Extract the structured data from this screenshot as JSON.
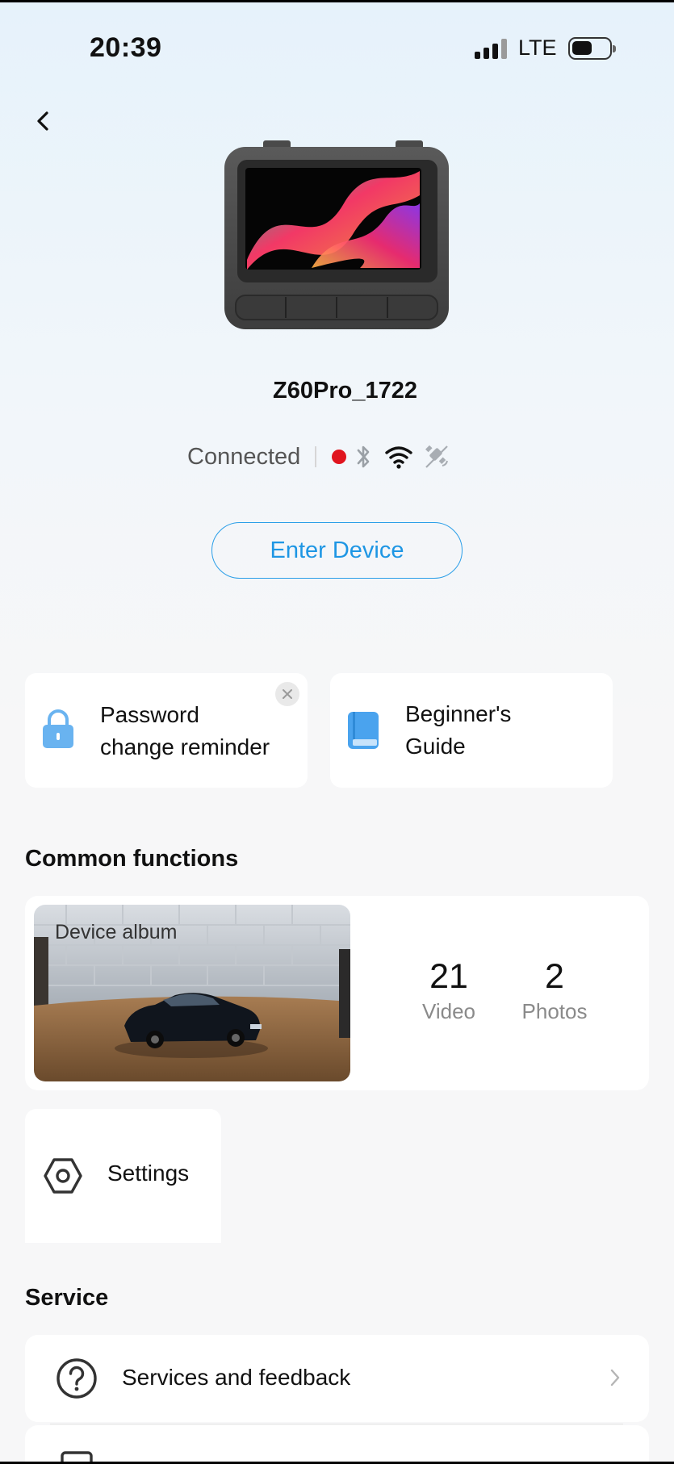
{
  "status_bar": {
    "time": "20:39",
    "network": "LTE",
    "signal_bars": 4,
    "battery_level": 0.5
  },
  "header": {
    "back_icon": "chevron-left-icon"
  },
  "device": {
    "name": "Z60Pro_1722",
    "status": "Connected",
    "status_icons": [
      "recording-dot-icon",
      "bluetooth-icon",
      "wifi-icon",
      "gps-off-icon"
    ],
    "recording_color": "#e0141e"
  },
  "enter_button": {
    "label": "Enter Device"
  },
  "quick_cards": {
    "reminder_line1": "Password",
    "reminder_line2": "change reminder",
    "guide_line1": "Beginner's",
    "guide_line2": "Guide"
  },
  "common_functions": {
    "title": "Common functions",
    "album": {
      "label": "Device album",
      "video_count": "21",
      "video_label": "Video",
      "photo_count": "2",
      "photo_label": "Photos"
    },
    "settings_label": "Settings"
  },
  "service": {
    "title": "Service",
    "items": [
      {
        "label": "Services and feedback",
        "icon": "question-circle-icon"
      }
    ]
  },
  "accent_color": "#1e96e4"
}
